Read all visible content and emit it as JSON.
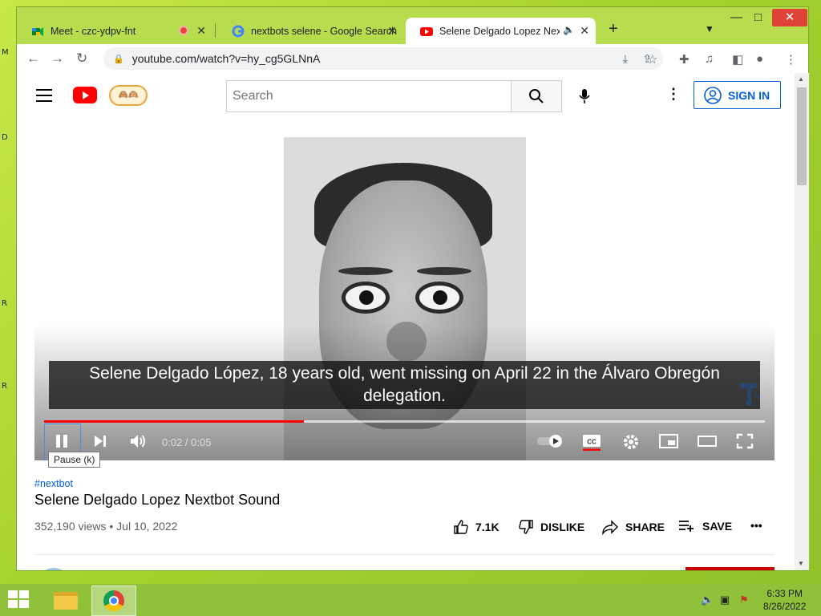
{
  "desktop": {
    "edge_letters": [
      "M",
      "D",
      "R",
      "R"
    ]
  },
  "browser": {
    "tabs": [
      {
        "title": "Meet - czc-ydpv-fnt",
        "favicon": "google-meet-icon",
        "status": "recording-dot-icon"
      },
      {
        "title": "nextbots selene - Google Search",
        "favicon": "google-g-icon"
      },
      {
        "title": "Selene Delgado Lopez Nextb",
        "favicon": "youtube-icon",
        "status": "audio-playing-icon",
        "active": true
      }
    ],
    "new_tab": "+",
    "url": "youtube.com/watch?v=hy_cg5GLNnA",
    "window_controls": {
      "minimize": "—",
      "maximize": "□",
      "close": "✕"
    }
  },
  "youtube": {
    "search_placeholder": "Search",
    "sign_in_label": "SIGN IN",
    "doodle_text": "🙈🙉",
    "player": {
      "caption": "Selene Delgado López, 18 years old, went missing on April 22 in the Álvaro Obregón delegation.",
      "time": "0:02 / 0:05",
      "progress_played": 0.36,
      "progress_loaded": 1.0,
      "tooltip": "Pause (k)",
      "autoplay_on": true
    },
    "video": {
      "hashtag": "#nextbot",
      "title": "Selene Delgado Lopez Nextbot Sound",
      "meta": "352,190 views • Jul 10, 2022"
    },
    "actions": [
      {
        "label": "7.1K",
        "icon": "thumbs-up-icon"
      },
      {
        "label": "DISLIKE",
        "icon": "thumbs-down-icon"
      },
      {
        "label": "SHARE",
        "icon": "share-icon"
      },
      {
        "label": "SAVE",
        "icon": "add-to-playlist-icon"
      }
    ],
    "more_label": "•••"
  },
  "taskbar": {
    "clock_time": "6:33 PM",
    "clock_date": "8/26/2022"
  },
  "colors": {
    "youtube_red": "#ff0000",
    "link_blue": "#065fd4",
    "desktop_green": "#a6d12f",
    "tab_strip": "#b7dc4d"
  }
}
